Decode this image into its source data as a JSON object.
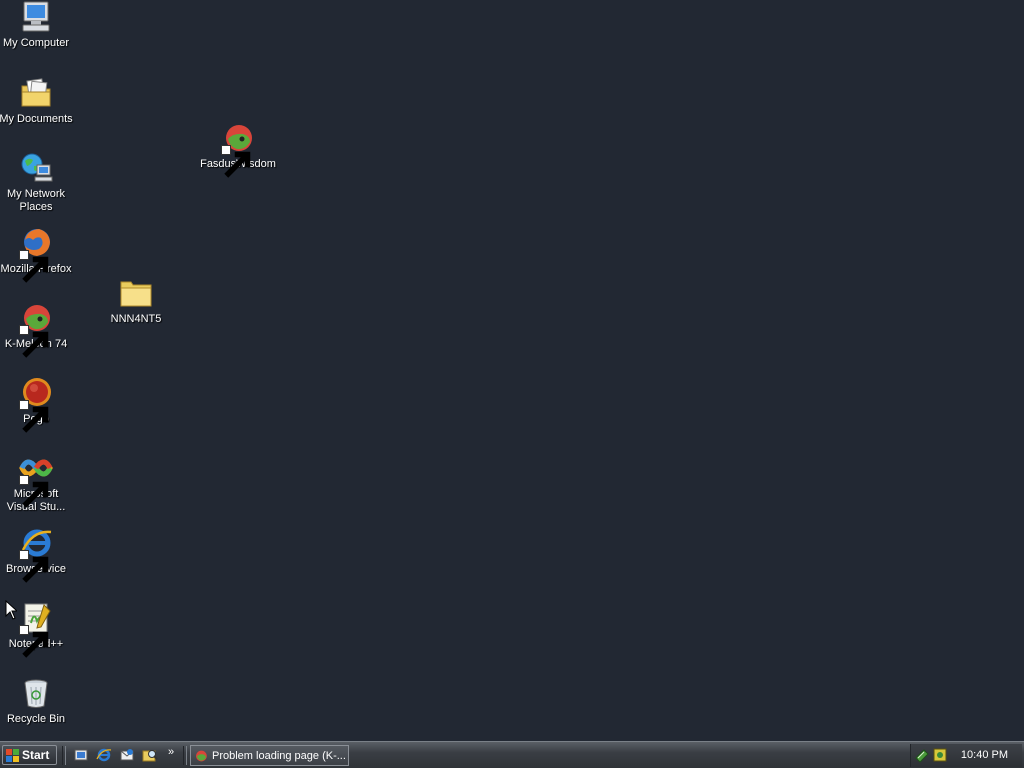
{
  "desktop": {
    "icons": [
      {
        "label": "My Computer",
        "icon": "computer-icon"
      },
      {
        "label": "My Documents",
        "icon": "documents-folder-icon"
      },
      {
        "label": "My Network Places",
        "icon": "network-places-icon"
      },
      {
        "label": "Mozilla Firefox",
        "icon": "firefox-icon"
      },
      {
        "label": "K-Meleon 74",
        "icon": "k-meleon-icon"
      },
      {
        "label": "Pego",
        "icon": "pego-icon"
      },
      {
        "label": "Microsoft Visual Stu...",
        "icon": "visual-studio-icon"
      },
      {
        "label": "Browservice",
        "icon": "internet-explorer-icon"
      },
      {
        "label": "Notepad++",
        "icon": "notepad-plus-plus-icon"
      },
      {
        "label": "Recycle Bin",
        "icon": "recycle-bin-icon"
      },
      {
        "label": "NNN4NT5",
        "icon": "folder-icon"
      },
      {
        "label": "FasdusWisdom",
        "icon": "k-meleon-icon"
      }
    ]
  },
  "taskbar": {
    "start_label": "Start",
    "overflow_chevron": "»",
    "task_label": "Problem loading page (K-...",
    "clock": "10:40 PM"
  },
  "colors": {
    "desktop_background": "#222833",
    "taskbar": "#3a3e44"
  }
}
